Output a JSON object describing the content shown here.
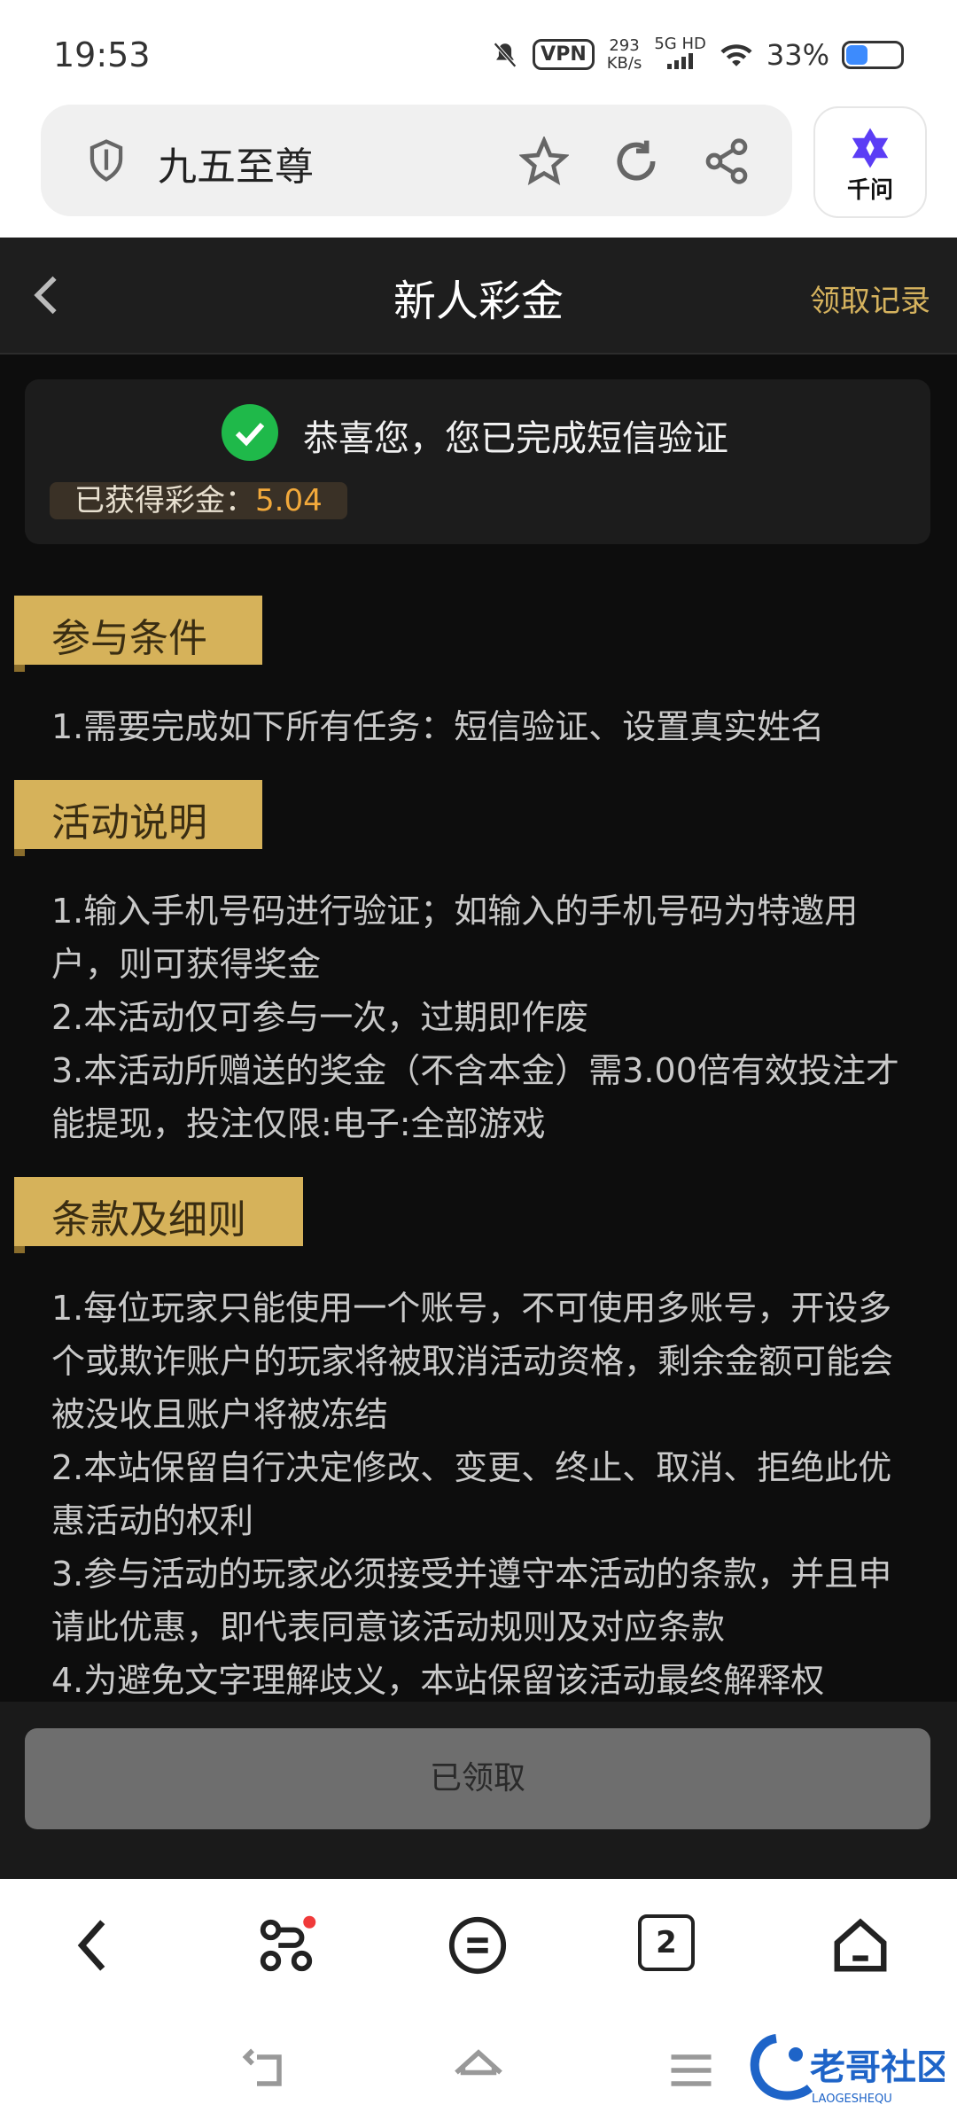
{
  "status_bar": {
    "time": "19:53",
    "vpn": "VPN",
    "speed_value": "293",
    "speed_unit": "KB/s",
    "network": "5G HD",
    "battery": "33%"
  },
  "browser": {
    "url_text": "九五至尊",
    "assistant_label": "千问"
  },
  "header": {
    "title": "新人彩金",
    "records_link": "领取记录"
  },
  "result_card": {
    "message": "恭喜您，您已完成短信验证",
    "reward_label": "已获得彩金：",
    "reward_amount": "5.04"
  },
  "sections": {
    "conditions": {
      "title": "参与条件",
      "lines": [
        "1.需要完成如下所有任务：短信验证、设置真实姓名"
      ]
    },
    "description": {
      "title": "活动说明",
      "lines": [
        "1.输入手机号码进行验证；如输入的手机号码为特邀用户，则可获得奖金",
        "2.本活动仅可参与一次，过期即作废",
        "3.本活动所赠送的奖金（不含本金）需3.00倍有效投注才能提现，投注仅限:电子:全部游戏"
      ]
    },
    "terms": {
      "title": "条款及细则",
      "lines": [
        "1.每位玩家只能使用一个账号，不可使用多账号，开设多个或欺诈账户的玩家将被取消活动资格，剩余金额可能会被没收且账户将被冻结",
        "2.本站保留自行决定修改、变更、终止、取消、拒绝此优惠活动的权利",
        "3.参与活动的玩家必须接受并遵守本活动的条款，并且申请此优惠，即代表同意该活动规则及对应条款",
        "4.为避免文字理解歧义，本站保留该活动最终解释权"
      ]
    }
  },
  "claim_button": "已领取",
  "browser_nav": {
    "tabs_count": "2"
  },
  "watermark": {
    "text": "老哥社区",
    "subtext": "LAOGESHEQU"
  },
  "colors": {
    "gold": "#d6b25a",
    "accent_text": "#d6b35e",
    "amount": "#f2a93b",
    "success": "#1fb94a"
  }
}
